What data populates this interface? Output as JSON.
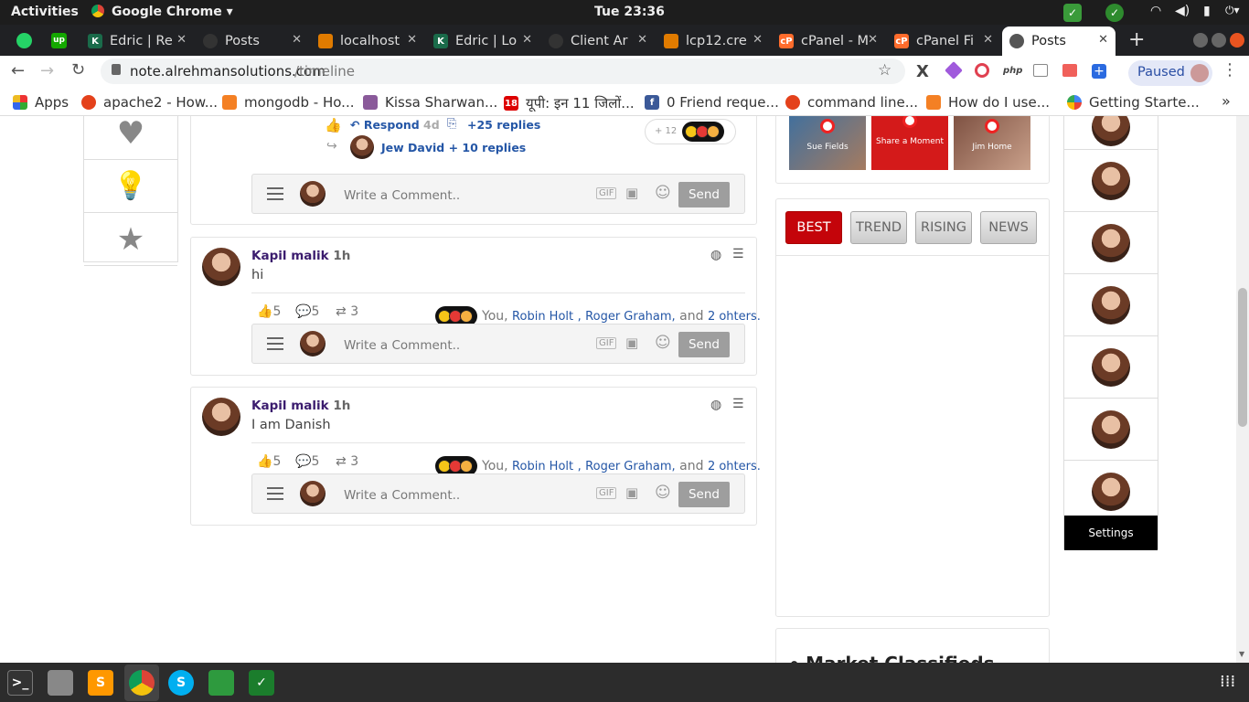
{
  "topbar": {
    "activities": "Activities",
    "app": "Google Chrome ▾",
    "clock": "Tue 23:36"
  },
  "tabs": [
    {
      "label": "Edric | Re",
      "icon": "k-icon"
    },
    {
      "label": "Posts",
      "icon": "globe-icon"
    },
    {
      "label": "localhost",
      "icon": "pma-icon"
    },
    {
      "label": "Edric | Lo",
      "icon": "k-icon"
    },
    {
      "label": "Client Ar",
      "icon": "circle-icon"
    },
    {
      "label": "lcp12.cre",
      "icon": "pma-icon"
    },
    {
      "label": "cPanel - M",
      "icon": "cpanel-icon"
    },
    {
      "label": "cPanel Fi",
      "icon": "cpanel-icon"
    },
    {
      "label": "Posts",
      "icon": "globe-icon"
    }
  ],
  "address": {
    "host": "note.alrehmansolutions.com",
    "path": "/timeline",
    "paused": "Paused"
  },
  "bookmarks": [
    {
      "label": "Apps"
    },
    {
      "label": "apache2 - How..."
    },
    {
      "label": "mongodb - Ho..."
    },
    {
      "label": "Kissa Sharwan..."
    },
    {
      "label": "यूपी: इन 11 जिलों..."
    },
    {
      "label": "0 Friend reque..."
    },
    {
      "label": "command line..."
    },
    {
      "label": "How do I use..."
    },
    {
      "label": "Getting Starte..."
    }
  ],
  "post0": {
    "respond": "Respond",
    "respond_time": "4d",
    "replies": "+25 replies",
    "reply_user": "Jew David",
    "reply_more": "+ 10 replies",
    "plus": "+ 12"
  },
  "comment_placeholder": "Write a Comment..",
  "send": "Send",
  "posts": [
    {
      "name": "Kapil malik",
      "time": "1h",
      "text": "hi",
      "likes": "5",
      "comments": "5",
      "shares": "3"
    },
    {
      "name": "Kapil malik",
      "time": "1h",
      "text": "I am Danish",
      "likes": "5",
      "comments": "5",
      "shares": "3"
    }
  ],
  "reactions": {
    "you": "You,",
    "p1": "Robin Holt",
    "sep": ",",
    "p2": "Roger Graham,",
    "and": "and",
    "more": "2 ohters."
  },
  "stories": [
    {
      "label": "Sue Fields"
    },
    {
      "label": "Share a Moment"
    },
    {
      "label": "Jim Home"
    }
  ],
  "filter_tabs": [
    {
      "label": "BEST"
    },
    {
      "label": "TREND"
    },
    {
      "label": "RISING"
    },
    {
      "label": "NEWS"
    }
  ],
  "market": "Market Classifieds",
  "settings": "Settings",
  "colors": {
    "active_tab": "#c4040a",
    "name": "#3b1c6e",
    "link": "#2456a6"
  }
}
